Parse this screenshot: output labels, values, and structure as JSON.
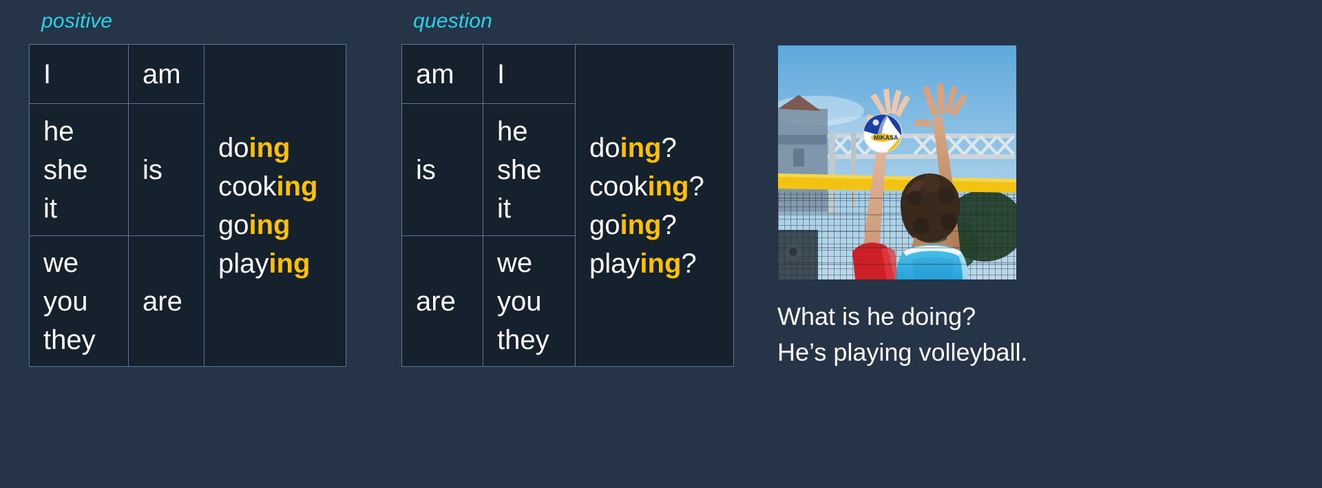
{
  "headings": {
    "positive": "positive",
    "question": "question"
  },
  "colors": {
    "page_background": "#253446",
    "cell_background": "#16212e",
    "border": "#5b7897",
    "heading": "#25D3ED",
    "accent": "#FFC000",
    "text": "#FFFFFF"
  },
  "positive_table": {
    "rows": [
      {
        "subject": "I",
        "verb": "am"
      },
      {
        "subject": "he\nshe\nit",
        "verb": "is"
      },
      {
        "subject": "we\nyou\nthey",
        "verb": "are"
      }
    ],
    "phrases": [
      {
        "stem": "do",
        "suffix": "ing",
        "mark": ""
      },
      {
        "stem": "cook",
        "suffix": "ing",
        "mark": ""
      },
      {
        "stem": "go",
        "suffix": "ing",
        "mark": ""
      },
      {
        "stem": "play",
        "suffix": "ing",
        "mark": ""
      }
    ]
  },
  "question_table": {
    "rows": [
      {
        "verb": "am",
        "subject": "I"
      },
      {
        "verb": "is",
        "subject": "he\nshe\nit"
      },
      {
        "verb": "are",
        "subject": "we\nyou\nthey"
      }
    ],
    "phrases": [
      {
        "stem": "do",
        "suffix": "ing",
        "mark": "?"
      },
      {
        "stem": "cook",
        "suffix": "ing",
        "mark": "?"
      },
      {
        "stem": "go",
        "suffix": "ing",
        "mark": "?"
      },
      {
        "stem": "play",
        "suffix": "ing",
        "mark": "?"
      }
    ]
  },
  "photo": {
    "alt": "beach volleyball players blocking at the net",
    "sky_color": "#8ec4e6",
    "net_tape_color": "#F2C313",
    "jersey_color": "#3ab4e8",
    "opponent_jersey_color": "#cc2026",
    "ball_blue": "#1b3fa0",
    "ball_yellow": "#f0c419",
    "ball_brand": "MIKASA"
  },
  "caption": {
    "line1": "What is he doing?",
    "line2": "He’s playing volleyball."
  }
}
